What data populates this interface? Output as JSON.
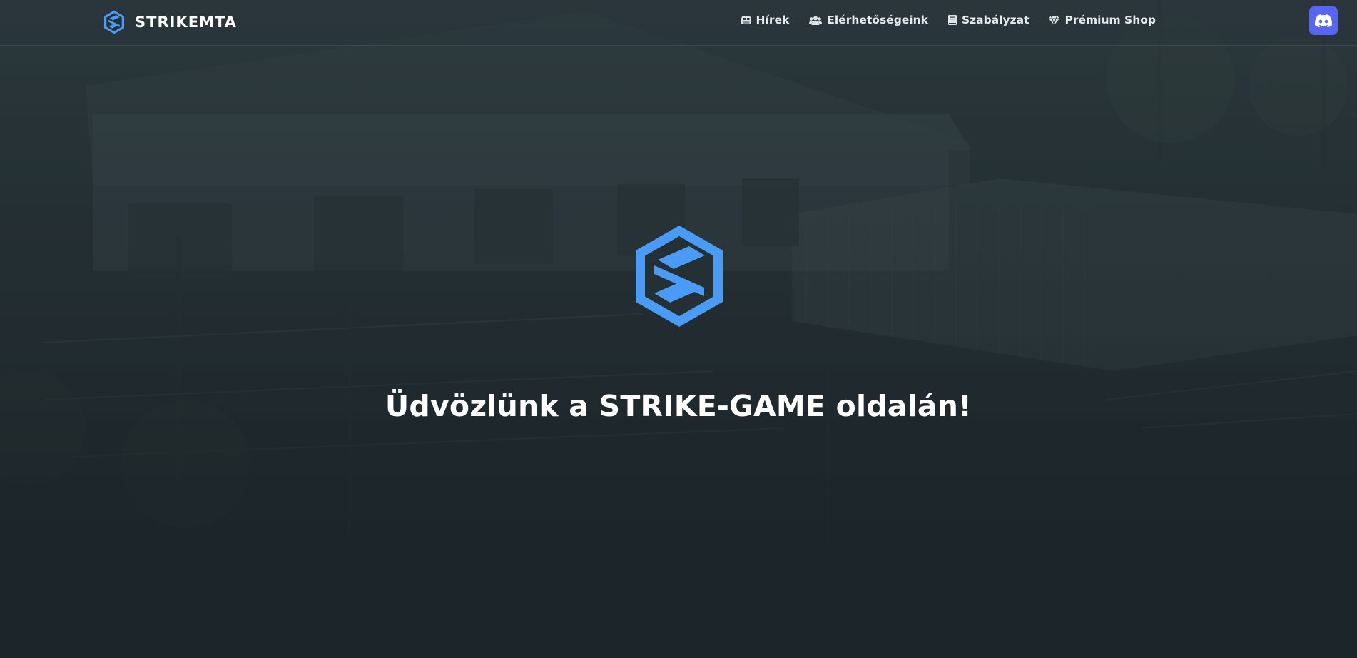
{
  "brand": {
    "name": "STRIKEMTA",
    "logo_icon": "strike-s-hexagon-icon",
    "accent_color": "#4a9bf5"
  },
  "nav": {
    "items": [
      {
        "label": "Hírek",
        "icon": "newspaper-icon"
      },
      {
        "label": "Elérhetőségeink",
        "icon": "users-icon"
      },
      {
        "label": "Szabályzat",
        "icon": "book-icon"
      },
      {
        "label": "Prémium Shop",
        "icon": "gem-icon"
      }
    ],
    "discord": {
      "icon": "discord-icon",
      "color": "#5865f2"
    }
  },
  "hero": {
    "logo_icon": "strike-s-hexagon-icon",
    "title": "Üdvözlünk a STRIKE-GAME oldalán!"
  }
}
